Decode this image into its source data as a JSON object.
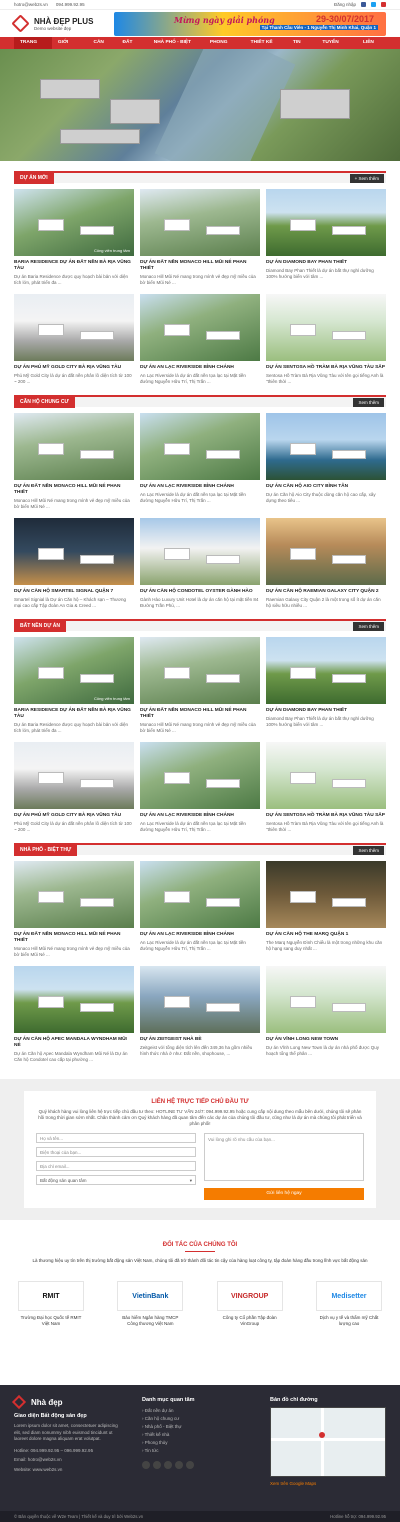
{
  "topbar": {
    "email": "hotro@web2s.vn",
    "phone": "094.999.92.95",
    "login": "Đăng nhập"
  },
  "header": {
    "logo_title": "NHÀ ĐẸP PLUS",
    "logo_sub": "Demo website đẹp",
    "banner_script": "Mừng ngày giải phóng",
    "banner_date": "29-30/07/2017",
    "banner_addr": "Tại Thanh Cầu Viên - 1 Nguyễn Thị Minh Khai, Quận 1"
  },
  "nav": [
    "TRANG CHỦ",
    "GIỚI THIỆU",
    "CĂN HỘ",
    "ĐẤT NỀN",
    "NHÀ PHỐ - BIỆT THỰ",
    "PHONG THỦY",
    "THIẾT KẾ NHÀ",
    "TIN TỨC",
    "TUYỂN DỤNG",
    "LIÊN HỆ"
  ],
  "sections": [
    {
      "title": "DỰ ÁN MỚI",
      "more": "+ Xem thêm",
      "cards": [
        {
          "t": "BARIA RESIDENCE DỰ ÁN ĐẤT NỀN BÀ RỊA VŨNG TÀU",
          "d": "Dự án Baria Residence được quy hoạch bài bản với diện tích lớn, phát triển đa ...",
          "g": "g1",
          "tag": "Công viên trung tâm"
        },
        {
          "t": "DỰ ÁN ĐẤT NỀN MONACO HILL MŨI NÉ PHAN THIẾT",
          "d": "Monaco Hill Mũi Né mang trong mình vẻ đẹp mỹ miều của bờ biển Mũi Né ...",
          "g": "g2",
          "tag": ""
        },
        {
          "t": "DỰ ÁN DIAMOND BAY PHAN THIẾT",
          "d": "Diamond Bay Phan Thiết là dự án bất thự nghỉ dưỡng 100% hướng biển với tâm ...",
          "g": "g3",
          "tag": ""
        },
        {
          "t": "DỰ ÁN PHÚ MỸ GOLD CITY BÀ RỊA VŨNG TÀU",
          "d": "Phú Mỹ Gold City là dự án đất nền phân lô diện tích từ 100 ~ 200 ...",
          "g": "g4",
          "tag": ""
        },
        {
          "t": "DỰ ÁN AN LẠC RIVERSIDE BÌNH CHÁNH",
          "d": "An Lạc Riverside là dự án đất nền tọa lạc tại Mặt tiền đường Nguyễn Hữu Trí, Thị Trấn ...",
          "g": "g5",
          "tag": ""
        },
        {
          "t": "DỰ ÁN SENTOSA HỒ TRÀM BÀ RỊA VŨNG TÀU SẮP",
          "d": "Sentosa Hồ Tràm Bà Rịa Vũng Tàu với tên gọi tiếng Anh là \"thiên thời ...",
          "g": "g12",
          "tag": ""
        }
      ]
    },
    {
      "title": "CĂN HỘ CHUNG CƯ",
      "more": "Xem thêm",
      "cards": [
        {
          "t": "DỰ ÁN ĐẤT NỀN MONACO HILL MŨI NÉ PHAN THIẾT",
          "d": "Monaco Hill Mũi Né mang trong mình vẻ đẹp mỹ miều của bờ biển Mũi Né ...",
          "g": "g2",
          "tag": ""
        },
        {
          "t": "DỰ ÁN AN LẠC RIVERSIDE BÌNH CHÁNH",
          "d": "An Lạc Riverside là dự án đất nền tọa lạc tại Mặt tiền đường Nguyễn Hữu Trí, Thị Trấn ...",
          "g": "g5",
          "tag": ""
        },
        {
          "t": "DỰ ÁN CĂN HỘ AIO CITY BÌNH TÂN",
          "d": "Dự án Căn hộ Aio City thuộc dòng căn hộ cao cấp, xây dựng theo tiêu ...",
          "g": "g6",
          "tag": ""
        },
        {
          "t": "DỰ ÁN CĂN HỘ SMARTEL SIGNAL QUẬN 7",
          "d": "Smartel Signial là Dự án Căn hộ – Khách sạn – Thương mại cao cấp Tập đoàn An Gia & Creed ...",
          "g": "g7",
          "tag": ""
        },
        {
          "t": "DỰ ÁN CĂN HỘ CONDOTEL OYSTER GÀNH HÀO",
          "d": "Gành Hào Luxury Unit Hotel là dự án căn hộ tại mặt tiền 84 Đường Trần Phú, ...",
          "g": "g8",
          "tag": ""
        },
        {
          "t": "DỰ ÁN CĂN HỘ RAEMIAN GALAXY CITY QUẬN 2",
          "d": "Raemian Galaxy City Quận 2 là một trong số ít dự án căn hộ siêu hữu nhiều ...",
          "g": "g9",
          "tag": ""
        }
      ]
    },
    {
      "title": "BẤT NỀN DỰ ÁN",
      "more": "Xem thêm",
      "cards": [
        {
          "t": "BARIA RESIDENCE DỰ ÁN ĐẤT NỀN BÀ RỊA VŨNG TÀU",
          "d": "Dự án Baria Residence được quy hoạch bài bản với diện tích lớn, phát triển đa ...",
          "g": "g1",
          "tag": "Công viên trung tâm"
        },
        {
          "t": "DỰ ÁN ĐẤT NỀN MONACO HILL MŨI NÉ PHAN THIẾT",
          "d": "Monaco Hill Mũi Né mang trong mình vẻ đẹp mỹ miều của bờ biển Mũi Né ...",
          "g": "g2",
          "tag": ""
        },
        {
          "t": "DỰ ÁN DIAMOND BAY PHAN THIẾT",
          "d": "Diamond Bay Phan Thiết là dự án bất thự nghỉ dưỡng 100% hướng biển với tâm ...",
          "g": "g3",
          "tag": ""
        },
        {
          "t": "DỰ ÁN PHÚ MỸ GOLD CITY BÀ RỊA VŨNG TÀU",
          "d": "Phú Mỹ Gold City là dự án đất nền phân lô diện tích từ 100 ~ 200 ...",
          "g": "g4",
          "tag": ""
        },
        {
          "t": "DỰ ÁN AN LẠC RIVERSIDE BÌNH CHÁNH",
          "d": "An Lạc Riverside là dự án đất nền tọa lạc tại Mặt tiền đường Nguyễn Hữu Trí, Thị Trấn ...",
          "g": "g5",
          "tag": ""
        },
        {
          "t": "DỰ ÁN SENTOSA HỒ TRÀM BÀ RỊA VŨNG TÀU SẮP",
          "d": "Sentosa Hồ Tràm Bà Rịa Vũng Tàu với tên gọi tiếng Anh là \"thiên thời ...",
          "g": "g12",
          "tag": ""
        }
      ]
    },
    {
      "title": "NHÀ PHỐ - BIỆT THỰ",
      "more": "Xem thêm",
      "cards": [
        {
          "t": "DỰ ÁN ĐẤT NỀN MONACO HILL MŨI NÉ PHAN THIẾT",
          "d": "Monaco Hill Mũi Né mang trong mình vẻ đẹp mỹ miều của bờ biển Mũi Né ...",
          "g": "g2",
          "tag": ""
        },
        {
          "t": "DỰ ÁN AN LẠC RIVERSIDE BÌNH CHÁNH",
          "d": "An Lạc Riverside là dự án đất nền tọa lạc tại Mặt tiền đường Nguyễn Hữu Trí, Thị Trấn ...",
          "g": "g5",
          "tag": ""
        },
        {
          "t": "DỰ ÁN CĂN HỘ THE MARQ QUẬN 1",
          "d": "The Marq Nguyễn Đình Chiểu là một trong những khu căn hộ hạng sang duy nhất ...",
          "g": "g11",
          "tag": ""
        },
        {
          "t": "DỰ ÁN CĂN HỘ APEC MANDALA WYNDHAM MŨI NÉ",
          "d": "Dự án Căn hộ Apec Mandala Wyndham Mũi Né là Dự án Căn hộ Condotel cao cấp tại phường ...",
          "g": "g3",
          "tag": ""
        },
        {
          "t": "DỰ ÁN ZEITGEIST NHÀ BÈ",
          "d": "Zeitgeist với tổng diện tích lên đến 349,36 ha gồm nhiều hình thức nhà ở như: Đất nền, shophouse, ...",
          "g": "g10",
          "tag": ""
        },
        {
          "t": "DỰ ÁN VĨNH LONG NEW TOWN",
          "d": "Dự án Vĩnh Long New Town là dự án nhà phố được Quy hoạch tổng thể phân ...",
          "g": "g12",
          "tag": ""
        }
      ]
    }
  ],
  "contact": {
    "title": "LIÊN HỆ TRỰC TIẾP CHỦ ĐẦU TƯ",
    "text": "Quý khách hàng vui lòng liên hệ trực tiếp chủ đầu tư theo: HOTLINE TƯ VẤN 24/7: 094.999.92.95 hoặc cung cấp nội dung theo mẫu bên dưới, chúng tôi sẽ phản hồi trong thời gian sớm nhất. Chân thành cảm ơn Quý khách hàng đã quan tâm đến các dự án của chúng tôi đầu tư, cũng như là dự án mà chúng tôi phát triển và phân phối!",
    "name_ph": "Họ và tên...",
    "phone_ph": "Điện thoại của bạn...",
    "email_ph": "Địa chỉ email...",
    "select": "Bất động sản quan tâm",
    "msg_ph": "Vui lòng ghi rõ nhu cầu của bạn...",
    "submit": "Gửi liên hệ ngay"
  },
  "partners": {
    "title": "ĐỐI TÁC CỦA CHÚNG TÔI",
    "text": "Là thương hiệu uy tín trên thị trường bất động sản Việt Nam, chúng tôi đã trở thành đối tác tin cậy của hàng loạt công ty, tập đoàn hàng đầu trong lĩnh vực bất động sản",
    "items": [
      {
        "logo": "RMIT",
        "name": "Trường Đại học Quốc tế RMIT Việt Nam",
        "color": "#111"
      },
      {
        "logo": "VietinBank",
        "name": "Bảo hiểm Ngân hàng TMCP Công thương Việt Nam",
        "color": "#0057a8"
      },
      {
        "logo": "VINGROUP",
        "name": "Công ty Cổ phần Tập đoàn VinGroup",
        "color": "#c62828"
      },
      {
        "logo": "Medisetter",
        "name": "Dịch vụ y tế và thẩm mỹ Chất lượng cao",
        "color": "#1e88e5"
      }
    ]
  },
  "footer": {
    "logo": "Nhà đẹp",
    "h1": "Giao diện Bất động sản đẹp",
    "about": "Lorem ipsum dolor sit amet, consectetuer adipiscing elit, sed diam nonummy nibh euismod tincidunt ut laoreet dolore magna aliquam erat volutpat.",
    "hotline": "Hotline: 094.999.92.95 – 096.999.92.95",
    "email": "Email: hotro@web2s.vn",
    "website": "Website: www.web2s.vn",
    "h2": "Danh mục quan tâm",
    "cats": [
      "Đất nền dự án",
      "Căn hộ chung cư",
      "Nhà phố - Biệt thự",
      "Thiết kế nhà",
      "Phong thủy",
      "Tin tức"
    ],
    "h3": "Bản đồ chỉ đường",
    "map_link": "Xem trên Google Maps"
  },
  "bottom": {
    "copy": "© Bản quyền thuộc về W2e Team | Thiết kế và duy trì bởi Web2s.vn",
    "hotline": "Hotline hỗ trợ: 094.999.92.95"
  }
}
